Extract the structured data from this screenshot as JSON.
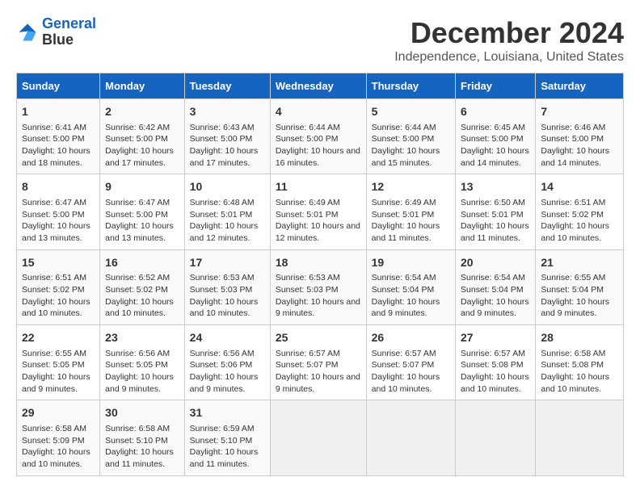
{
  "header": {
    "logo_line1": "General",
    "logo_line2": "Blue",
    "title": "December 2024",
    "subtitle": "Independence, Louisiana, United States"
  },
  "days_of_week": [
    "Sunday",
    "Monday",
    "Tuesday",
    "Wednesday",
    "Thursday",
    "Friday",
    "Saturday"
  ],
  "weeks": [
    [
      {
        "day": "1",
        "info": "Sunrise: 6:41 AM\nSunset: 5:00 PM\nDaylight: 10 hours and 18 minutes."
      },
      {
        "day": "2",
        "info": "Sunrise: 6:42 AM\nSunset: 5:00 PM\nDaylight: 10 hours and 17 minutes."
      },
      {
        "day": "3",
        "info": "Sunrise: 6:43 AM\nSunset: 5:00 PM\nDaylight: 10 hours and 17 minutes."
      },
      {
        "day": "4",
        "info": "Sunrise: 6:44 AM\nSunset: 5:00 PM\nDaylight: 10 hours and 16 minutes."
      },
      {
        "day": "5",
        "info": "Sunrise: 6:44 AM\nSunset: 5:00 PM\nDaylight: 10 hours and 15 minutes."
      },
      {
        "day": "6",
        "info": "Sunrise: 6:45 AM\nSunset: 5:00 PM\nDaylight: 10 hours and 14 minutes."
      },
      {
        "day": "7",
        "info": "Sunrise: 6:46 AM\nSunset: 5:00 PM\nDaylight: 10 hours and 14 minutes."
      }
    ],
    [
      {
        "day": "8",
        "info": "Sunrise: 6:47 AM\nSunset: 5:00 PM\nDaylight: 10 hours and 13 minutes."
      },
      {
        "day": "9",
        "info": "Sunrise: 6:47 AM\nSunset: 5:00 PM\nDaylight: 10 hours and 13 minutes."
      },
      {
        "day": "10",
        "info": "Sunrise: 6:48 AM\nSunset: 5:01 PM\nDaylight: 10 hours and 12 minutes."
      },
      {
        "day": "11",
        "info": "Sunrise: 6:49 AM\nSunset: 5:01 PM\nDaylight: 10 hours and 12 minutes."
      },
      {
        "day": "12",
        "info": "Sunrise: 6:49 AM\nSunset: 5:01 PM\nDaylight: 10 hours and 11 minutes."
      },
      {
        "day": "13",
        "info": "Sunrise: 6:50 AM\nSunset: 5:01 PM\nDaylight: 10 hours and 11 minutes."
      },
      {
        "day": "14",
        "info": "Sunrise: 6:51 AM\nSunset: 5:02 PM\nDaylight: 10 hours and 10 minutes."
      }
    ],
    [
      {
        "day": "15",
        "info": "Sunrise: 6:51 AM\nSunset: 5:02 PM\nDaylight: 10 hours and 10 minutes."
      },
      {
        "day": "16",
        "info": "Sunrise: 6:52 AM\nSunset: 5:02 PM\nDaylight: 10 hours and 10 minutes."
      },
      {
        "day": "17",
        "info": "Sunrise: 6:53 AM\nSunset: 5:03 PM\nDaylight: 10 hours and 10 minutes."
      },
      {
        "day": "18",
        "info": "Sunrise: 6:53 AM\nSunset: 5:03 PM\nDaylight: 10 hours and 9 minutes."
      },
      {
        "day": "19",
        "info": "Sunrise: 6:54 AM\nSunset: 5:04 PM\nDaylight: 10 hours and 9 minutes."
      },
      {
        "day": "20",
        "info": "Sunrise: 6:54 AM\nSunset: 5:04 PM\nDaylight: 10 hours and 9 minutes."
      },
      {
        "day": "21",
        "info": "Sunrise: 6:55 AM\nSunset: 5:04 PM\nDaylight: 10 hours and 9 minutes."
      }
    ],
    [
      {
        "day": "22",
        "info": "Sunrise: 6:55 AM\nSunset: 5:05 PM\nDaylight: 10 hours and 9 minutes."
      },
      {
        "day": "23",
        "info": "Sunrise: 6:56 AM\nSunset: 5:05 PM\nDaylight: 10 hours and 9 minutes."
      },
      {
        "day": "24",
        "info": "Sunrise: 6:56 AM\nSunset: 5:06 PM\nDaylight: 10 hours and 9 minutes."
      },
      {
        "day": "25",
        "info": "Sunrise: 6:57 AM\nSunset: 5:07 PM\nDaylight: 10 hours and 9 minutes."
      },
      {
        "day": "26",
        "info": "Sunrise: 6:57 AM\nSunset: 5:07 PM\nDaylight: 10 hours and 10 minutes."
      },
      {
        "day": "27",
        "info": "Sunrise: 6:57 AM\nSunset: 5:08 PM\nDaylight: 10 hours and 10 minutes."
      },
      {
        "day": "28",
        "info": "Sunrise: 6:58 AM\nSunset: 5:08 PM\nDaylight: 10 hours and 10 minutes."
      }
    ],
    [
      {
        "day": "29",
        "info": "Sunrise: 6:58 AM\nSunset: 5:09 PM\nDaylight: 10 hours and 10 minutes."
      },
      {
        "day": "30",
        "info": "Sunrise: 6:58 AM\nSunset: 5:10 PM\nDaylight: 10 hours and 11 minutes."
      },
      {
        "day": "31",
        "info": "Sunrise: 6:59 AM\nSunset: 5:10 PM\nDaylight: 10 hours and 11 minutes."
      },
      null,
      null,
      null,
      null
    ]
  ]
}
